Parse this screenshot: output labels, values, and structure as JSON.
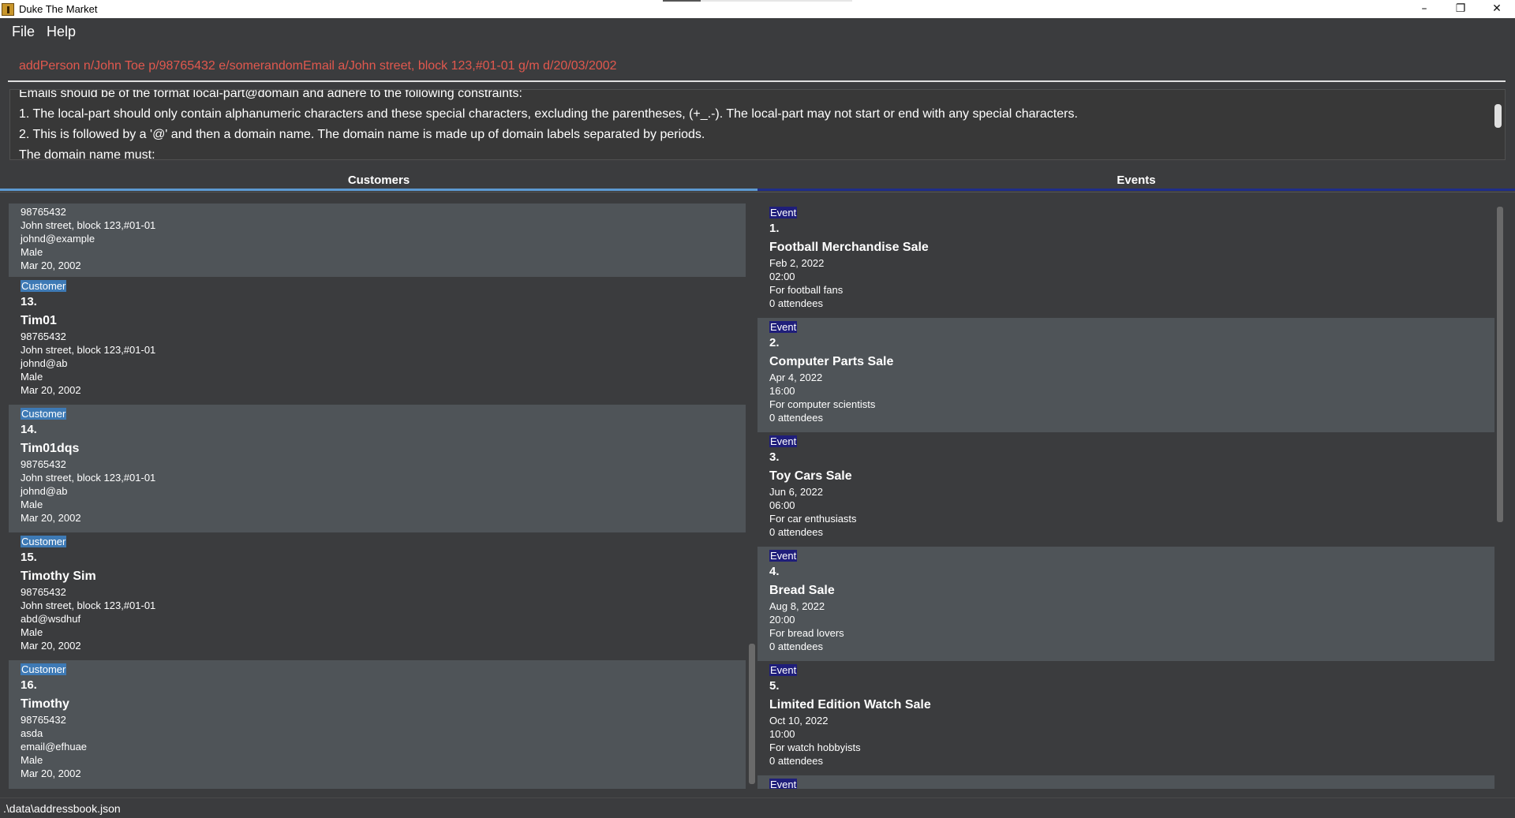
{
  "window": {
    "title": "Duke The Market",
    "minimize_glyph": "–",
    "maximize_glyph": "❐",
    "close_glyph": "✕"
  },
  "menu": {
    "items": [
      {
        "label": "File"
      },
      {
        "label": "Help"
      }
    ]
  },
  "command": {
    "value": "addPerson n/John Toe p/98765432 e/somerandomEmail a/John street, block 123,#01-01 g/m d/20/03/2002"
  },
  "result": {
    "lines": [
      "Emails should be of the format local-part@domain and adhere to the following constraints:",
      "1. The local-part should only contain alphanumeric characters and these special characters, excluding the parentheses, (+_.-). The local-part may not start or end with any special characters.",
      "2. This is followed by a '@' and then a domain name. The domain name is made up of domain labels separated by periods.",
      "The domain name must:"
    ]
  },
  "tabs": {
    "customers": "Customers",
    "events": "Events"
  },
  "customers": {
    "partial": {
      "phone": "98765432",
      "address": "John street, block 123,#01-01",
      "email": "johnd@example",
      "gender": "Male",
      "birthday": "Mar 20, 2002"
    },
    "items": [
      {
        "tag": "Customer",
        "index": "13.",
        "name": "Tim01",
        "phone": "98765432",
        "address": "John street, block 123,#01-01",
        "email": "johnd@ab",
        "gender": "Male",
        "birthday": "Mar 20, 2002"
      },
      {
        "tag": "Customer",
        "index": "14.",
        "name": "Tim01dqs",
        "phone": "98765432",
        "address": "John street, block 123,#01-01",
        "email": "johnd@ab",
        "gender": "Male",
        "birthday": "Mar 20, 2002"
      },
      {
        "tag": "Customer",
        "index": "15.",
        "name": "Timothy Sim",
        "phone": "98765432",
        "address": "John street, block 123,#01-01",
        "email": "abd@wsdhuf",
        "gender": "Male",
        "birthday": "Mar 20, 2002"
      },
      {
        "tag": "Customer",
        "index": "16.",
        "name": "Timothy",
        "phone": "98765432",
        "address": "asda",
        "email": "email@efhuae",
        "gender": "Male",
        "birthday": "Mar 20, 2002"
      }
    ]
  },
  "events": {
    "items": [
      {
        "tag": "Event",
        "index": "1.",
        "name": "Football Merchandise Sale",
        "date": "Feb 2, 2022",
        "time": "02:00",
        "purpose": "For football fans",
        "attendees": "0 attendees"
      },
      {
        "tag": "Event",
        "index": "2.",
        "name": "Computer Parts Sale",
        "date": "Apr 4, 2022",
        "time": "16:00",
        "purpose": "For computer scientists",
        "attendees": "0 attendees"
      },
      {
        "tag": "Event",
        "index": "3.",
        "name": "Toy Cars Sale",
        "date": "Jun 6, 2022",
        "time": "06:00",
        "purpose": "For car enthusiasts",
        "attendees": "0 attendees"
      },
      {
        "tag": "Event",
        "index": "4.",
        "name": "Bread Sale",
        "date": "Aug 8, 2022",
        "time": "20:00",
        "purpose": "For bread lovers",
        "attendees": "0 attendees"
      },
      {
        "tag": "Event",
        "index": "5.",
        "name": "Limited Edition Watch Sale",
        "date": "Oct 10, 2022",
        "time": "10:00",
        "purpose": "For watch hobbyists",
        "attendees": "0 attendees"
      },
      {
        "tag": "Event"
      }
    ]
  },
  "status": {
    "path": ".\\data\\addressbook.json"
  }
}
